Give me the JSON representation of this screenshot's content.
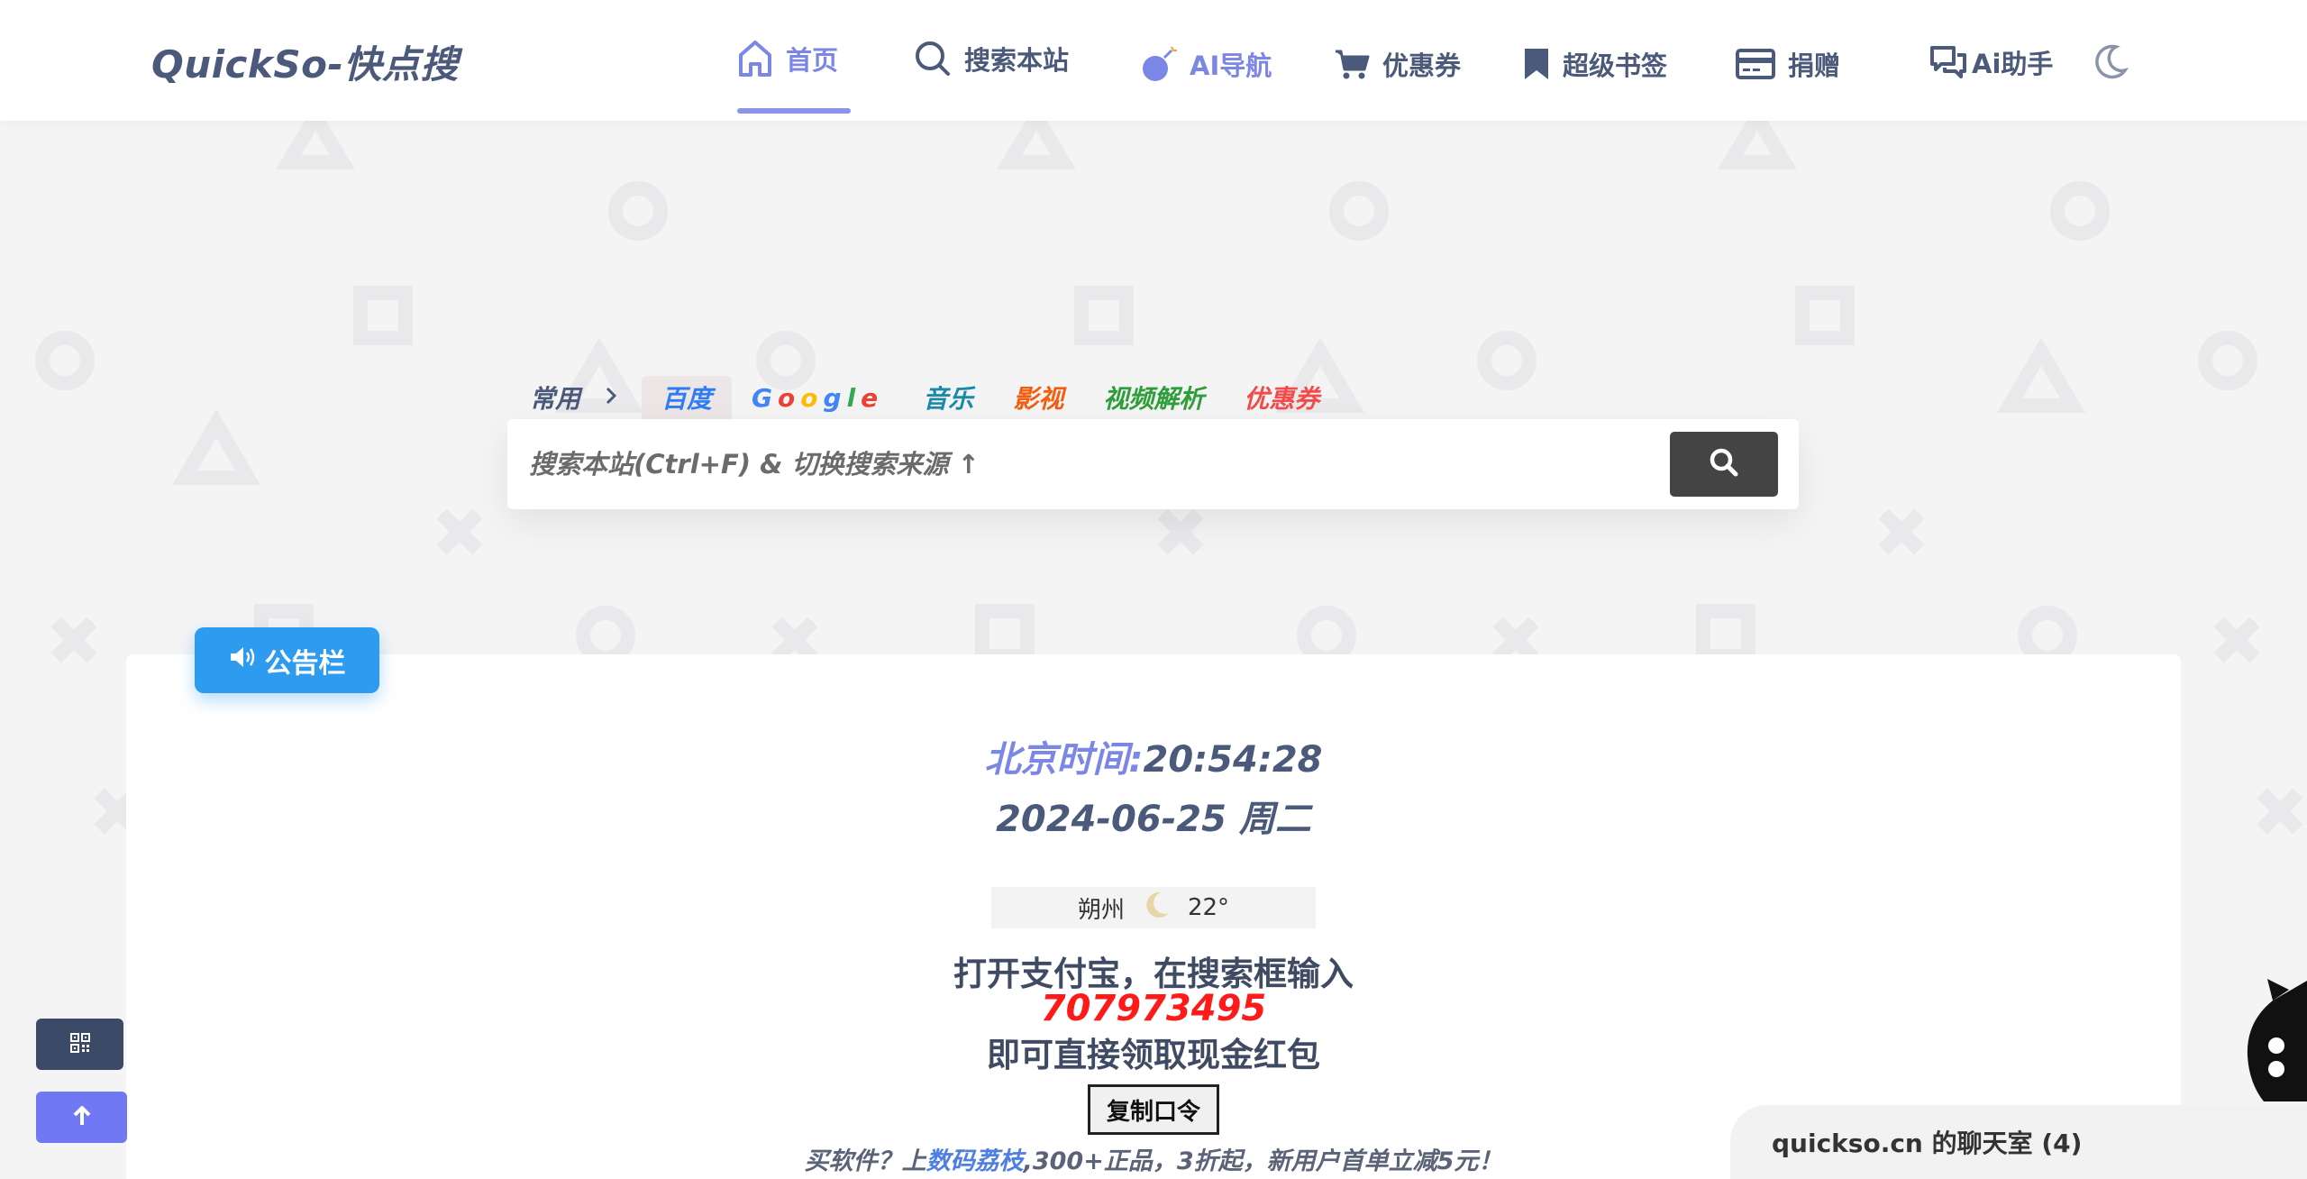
{
  "header": {
    "logo": "QuickSo-快点搜",
    "nav": [
      {
        "label": "首页",
        "icon": "home-icon",
        "active": true
      },
      {
        "label": "搜索本站",
        "icon": "search-icon",
        "active": false
      },
      {
        "label": "AI导航",
        "icon": "bomb-icon",
        "active": false
      },
      {
        "label": "优惠券",
        "icon": "cart-icon",
        "active": false
      },
      {
        "label": "超级书签",
        "icon": "bookmark-icon",
        "active": false
      },
      {
        "label": "捐赠",
        "icon": "credit-card-icon",
        "active": false
      },
      {
        "label": "Ai助手",
        "icon": "chat-icon",
        "active": false
      }
    ],
    "theme_icon": "moon-icon"
  },
  "search": {
    "quick_label": "常用",
    "tabs": [
      {
        "label": "百度",
        "color": "#2f7cf6",
        "active": true
      },
      {
        "label": "Google",
        "color": "#4285f4",
        "active": false
      },
      {
        "label": "音乐",
        "color": "#1a8aa8",
        "active": false
      },
      {
        "label": "影视",
        "color": "#f25d10",
        "active": false
      },
      {
        "label": "视频解析",
        "color": "#2f9e3a",
        "active": false
      },
      {
        "label": "优惠券",
        "color": "#f24b4b",
        "active": false
      }
    ],
    "placeholder": "搜索本站(Ctrl+F) & 切换搜索来源 ↑"
  },
  "notice": {
    "button_label": "公告栏",
    "time_label": "北京时间:",
    "time_value": "20:54:28",
    "date": "2024-06-25 周二",
    "weather": {
      "city": "朔州",
      "temp": "22°",
      "icon": "moon-icon"
    },
    "promo_line1": "打开支付宝，在搜索框输入",
    "promo_code": "707973495",
    "promo_line2": "即可直接领取现金红包",
    "copy_button": "复制口令",
    "buy_prefix": "买软件？上",
    "buy_link": "数码荔枝",
    "buy_suffix": ",300+正品，3折起，新用户首单立减5元！"
  },
  "floating": {
    "qr_icon": "qr-code-icon",
    "top_icon": "arrow-up-icon"
  },
  "chat": {
    "label": "quickso.cn 的聊天室 (4)"
  },
  "colors": {
    "accent": "#7c86e6",
    "notice_blue": "#2d9bf0",
    "promo_red": "#ff1a1a",
    "nav_text": "#4b5a7a"
  }
}
